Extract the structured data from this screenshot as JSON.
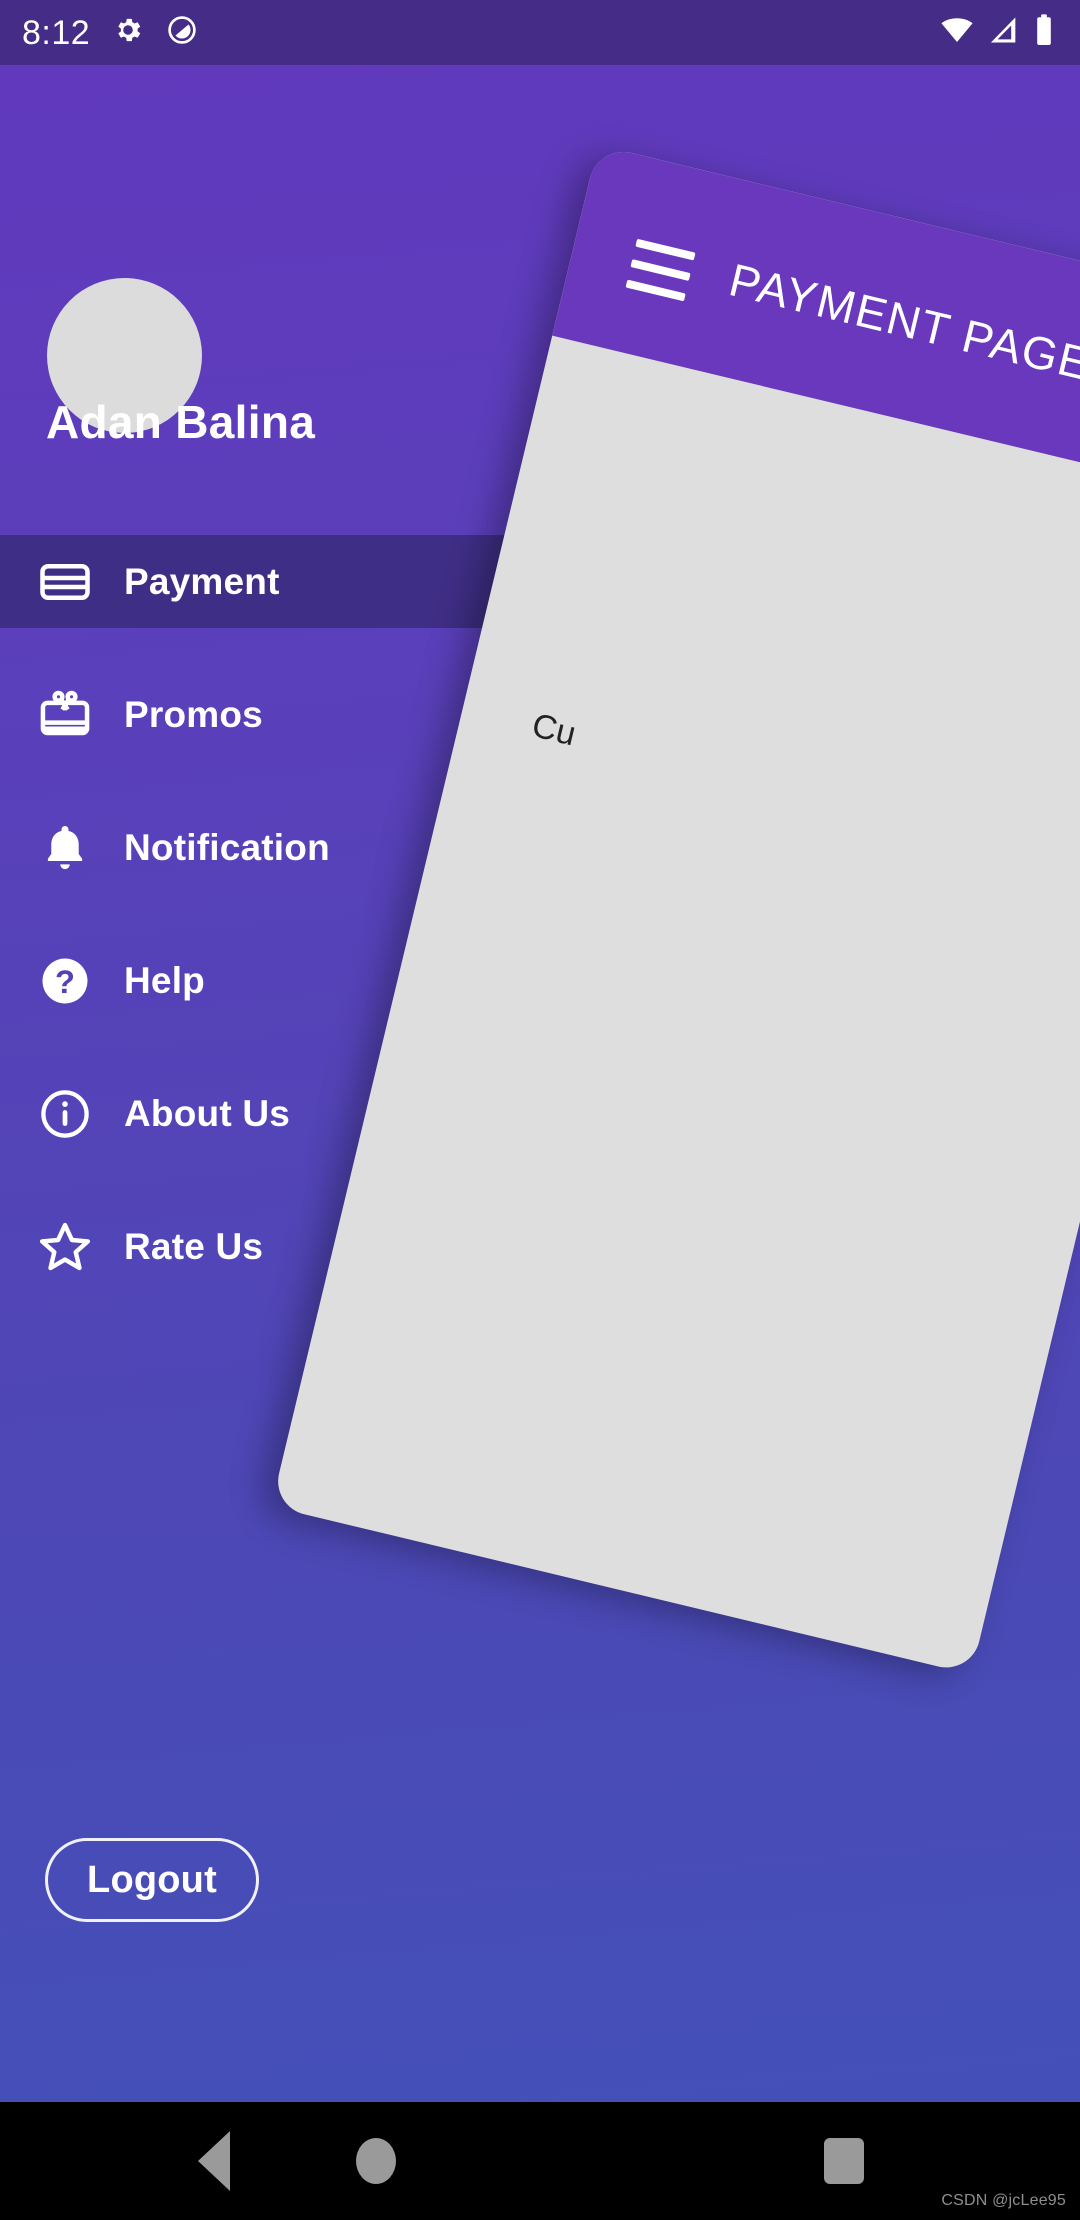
{
  "status_bar": {
    "time": "8:12",
    "left_icons": [
      "gear-icon",
      "do-not-disturb-icon"
    ],
    "right_icons": [
      "wifi-icon",
      "cellular-signal-icon",
      "battery-icon"
    ],
    "background_color": "#452C87"
  },
  "drawer": {
    "background_gradient_from": "#6139BC",
    "background_gradient_to": "#4450B8",
    "avatar": {
      "icon": "avatar-placeholder",
      "color": "#DCDCDC"
    },
    "username": "Adan Balina",
    "active_item_color": "#3F2E85",
    "items": [
      {
        "label": "Payment",
        "icon": "credit-card-icon",
        "active": true
      },
      {
        "label": "Promos",
        "icon": "gift-card-icon",
        "active": false
      },
      {
        "label": "Notification",
        "icon": "bell-icon",
        "active": false
      },
      {
        "label": "Help",
        "icon": "help-circle-icon",
        "active": false
      },
      {
        "label": "About Us",
        "icon": "info-circle-icon",
        "active": false
      },
      {
        "label": "Rate Us",
        "icon": "star-outline-icon",
        "active": false
      }
    ],
    "logout_label": "Logout"
  },
  "page_card": {
    "title": "PAYMENT PAGE",
    "menu_icon": "hamburger-menu-icon",
    "appbar_color": "#6938BC",
    "body_color": "#DEDEDE",
    "body_text": "Cu"
  },
  "nav_bar": {
    "back": "back-triangle-icon",
    "home": "home-circle-icon",
    "recents": "recents-square-icon",
    "watermark": "CSDN @jcLee95"
  }
}
